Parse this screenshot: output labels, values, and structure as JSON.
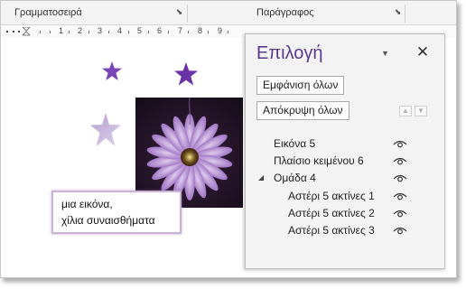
{
  "ribbon": {
    "groups": [
      {
        "label": "Γραμματοσειρά"
      },
      {
        "label": "Παράγραφος"
      }
    ]
  },
  "ruler": {
    "numbers": [
      "1",
      "2",
      "3",
      "4",
      "5",
      "6",
      "7",
      "8",
      "9"
    ]
  },
  "document": {
    "textbox_lines": [
      "μια εικόνα,",
      "χίλια συναισθήματα"
    ],
    "shape_colors": {
      "star_dark": "#6a3aa6",
      "star_light": "#c9b6dd",
      "flower": "#b892d8"
    }
  },
  "selection_pane": {
    "title": "Επιλογή",
    "show_all_label": "Εμφάνιση όλων",
    "hide_all_label": "Απόκρυψη όλων",
    "items": [
      {
        "label": "Εικόνα 5",
        "visible": true
      },
      {
        "label": "Πλαίσιο κειμένου 6",
        "visible": true
      },
      {
        "label": "Ομάδα 4",
        "visible": true,
        "expanded": true
      },
      {
        "label": "Αστέρι 5 ακτίνες 1",
        "visible": true
      },
      {
        "label": "Αστέρι 5 ακτίνες 2",
        "visible": true
      },
      {
        "label": "Αστέρι 5 ακτίνες 3",
        "visible": true
      }
    ]
  }
}
